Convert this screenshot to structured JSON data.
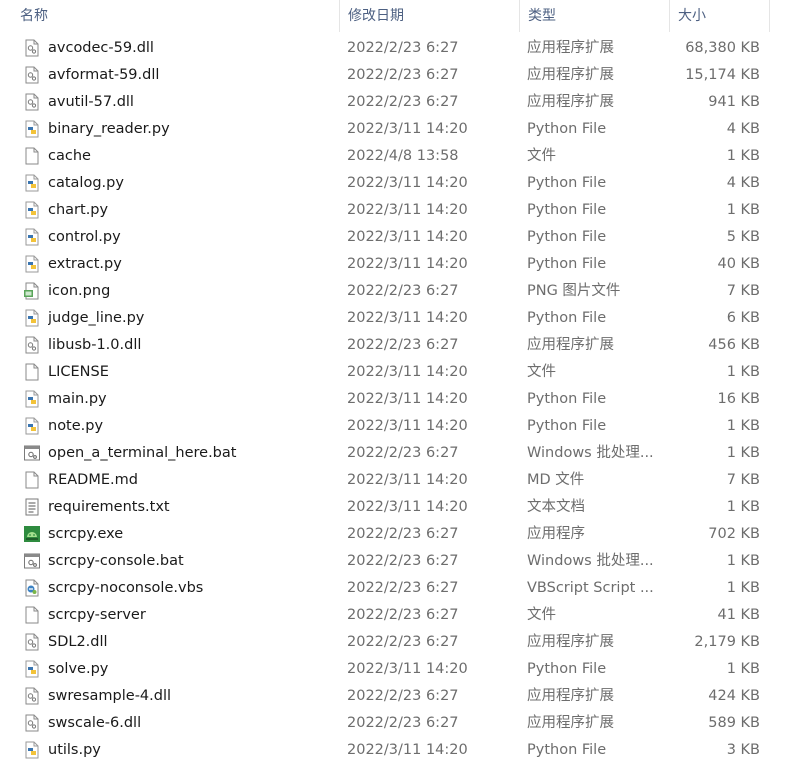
{
  "columns": {
    "name": "名称",
    "date": "修改日期",
    "type": "类型",
    "size": "大小"
  },
  "files": [
    {
      "name": "avcodec-59.dll",
      "date": "2022/2/23 6:27",
      "type": "应用程序扩展",
      "size": "68,380 KB",
      "icon": "dll-icon"
    },
    {
      "name": "avformat-59.dll",
      "date": "2022/2/23 6:27",
      "type": "应用程序扩展",
      "size": "15,174 KB",
      "icon": "dll-icon"
    },
    {
      "name": "avutil-57.dll",
      "date": "2022/2/23 6:27",
      "type": "应用程序扩展",
      "size": "941 KB",
      "icon": "dll-icon"
    },
    {
      "name": "binary_reader.py",
      "date": "2022/3/11 14:20",
      "type": "Python File",
      "size": "4 KB",
      "icon": "python-file-icon"
    },
    {
      "name": "cache",
      "date": "2022/4/8 13:58",
      "type": "文件",
      "size": "1 KB",
      "icon": "blank-file-icon"
    },
    {
      "name": "catalog.py",
      "date": "2022/3/11 14:20",
      "type": "Python File",
      "size": "4 KB",
      "icon": "python-file-icon"
    },
    {
      "name": "chart.py",
      "date": "2022/3/11 14:20",
      "type": "Python File",
      "size": "1 KB",
      "icon": "python-file-icon"
    },
    {
      "name": "control.py",
      "date": "2022/3/11 14:20",
      "type": "Python File",
      "size": "5 KB",
      "icon": "python-file-icon"
    },
    {
      "name": "extract.py",
      "date": "2022/3/11 14:20",
      "type": "Python File",
      "size": "40 KB",
      "icon": "python-file-icon"
    },
    {
      "name": "icon.png",
      "date": "2022/2/23 6:27",
      "type": "PNG 图片文件",
      "size": "7 KB",
      "icon": "image-file-icon"
    },
    {
      "name": "judge_line.py",
      "date": "2022/3/11 14:20",
      "type": "Python File",
      "size": "6 KB",
      "icon": "python-file-icon"
    },
    {
      "name": "libusb-1.0.dll",
      "date": "2022/2/23 6:27",
      "type": "应用程序扩展",
      "size": "456 KB",
      "icon": "dll-icon"
    },
    {
      "name": "LICENSE",
      "date": "2022/3/11 14:20",
      "type": "文件",
      "size": "1 KB",
      "icon": "blank-file-icon"
    },
    {
      "name": "main.py",
      "date": "2022/3/11 14:20",
      "type": "Python File",
      "size": "16 KB",
      "icon": "python-file-icon"
    },
    {
      "name": "note.py",
      "date": "2022/3/11 14:20",
      "type": "Python File",
      "size": "1 KB",
      "icon": "python-file-icon"
    },
    {
      "name": "open_a_terminal_here.bat",
      "date": "2022/2/23 6:27",
      "type": "Windows 批处理...",
      "size": "1 KB",
      "icon": "batch-file-icon"
    },
    {
      "name": "README.md",
      "date": "2022/3/11 14:20",
      "type": "MD 文件",
      "size": "7 KB",
      "icon": "blank-file-icon"
    },
    {
      "name": "requirements.txt",
      "date": "2022/3/11 14:20",
      "type": "文本文档",
      "size": "1 KB",
      "icon": "text-file-icon"
    },
    {
      "name": "scrcpy.exe",
      "date": "2022/2/23 6:27",
      "type": "应用程序",
      "size": "702 KB",
      "icon": "android-exe-icon"
    },
    {
      "name": "scrcpy-console.bat",
      "date": "2022/2/23 6:27",
      "type": "Windows 批处理...",
      "size": "1 KB",
      "icon": "batch-file-icon"
    },
    {
      "name": "scrcpy-noconsole.vbs",
      "date": "2022/2/23 6:27",
      "type": "VBScript Script ...",
      "size": "1 KB",
      "icon": "vbscript-file-icon"
    },
    {
      "name": "scrcpy-server",
      "date": "2022/2/23 6:27",
      "type": "文件",
      "size": "41 KB",
      "icon": "blank-file-icon"
    },
    {
      "name": "SDL2.dll",
      "date": "2022/2/23 6:27",
      "type": "应用程序扩展",
      "size": "2,179 KB",
      "icon": "dll-icon"
    },
    {
      "name": "solve.py",
      "date": "2022/3/11 14:20",
      "type": "Python File",
      "size": "1 KB",
      "icon": "python-file-icon"
    },
    {
      "name": "swresample-4.dll",
      "date": "2022/2/23 6:27",
      "type": "应用程序扩展",
      "size": "424 KB",
      "icon": "dll-icon"
    },
    {
      "name": "swscale-6.dll",
      "date": "2022/2/23 6:27",
      "type": "应用程序扩展",
      "size": "589 KB",
      "icon": "dll-icon"
    },
    {
      "name": "utils.py",
      "date": "2022/3/11 14:20",
      "type": "Python File",
      "size": "3 KB",
      "icon": "python-file-icon"
    }
  ]
}
